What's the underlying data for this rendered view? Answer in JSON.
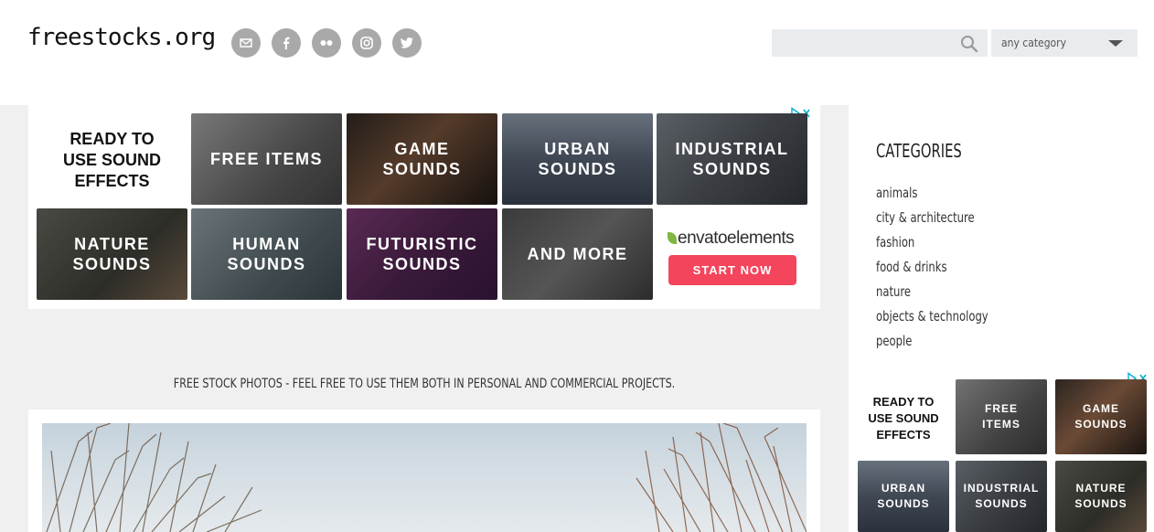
{
  "header": {
    "logo": "freestocks.org",
    "social": [
      "mail-icon",
      "facebook-icon",
      "flickr-icon",
      "instagram-icon",
      "twitter-icon"
    ],
    "search": {
      "placeholder": "",
      "value": ""
    },
    "category_select": "any category"
  },
  "ad_top": {
    "headline": [
      "READY TO",
      "USE SOUND",
      "EFFECTS"
    ],
    "tiles": [
      {
        "label": [
          "FREE ITEMS"
        ]
      },
      {
        "label": [
          "GAME",
          "SOUNDS"
        ]
      },
      {
        "label": [
          "URBAN",
          "SOUNDS"
        ]
      },
      {
        "label": [
          "INDUSTRIAL",
          "SOUNDS"
        ]
      },
      {
        "label": [
          "NATURE",
          "SOUNDS"
        ]
      },
      {
        "label": [
          "HUMAN",
          "SOUNDS"
        ]
      },
      {
        "label": [
          "FUTURISTIC",
          "SOUNDS"
        ]
      },
      {
        "label": [
          "AND MORE"
        ]
      }
    ],
    "brand": "envato",
    "brand_suffix": "elements",
    "cta": "START NOW"
  },
  "tagline": "FREE STOCK PHOTOS - FEEL FREE TO USE THEM BOTH IN PERSONAL AND COMMERCIAL PROJECTS.",
  "sidebar": {
    "title": "CATEGORIES",
    "items": [
      "animals",
      "city & architecture",
      "fashion",
      "food & drinks",
      "nature",
      "objects & technology",
      "people"
    ]
  },
  "ad_side": {
    "headline": [
      "READY TO",
      "USE SOUND",
      "EFFECTS"
    ],
    "tiles": [
      {
        "label": [
          "FREE",
          "ITEMS"
        ]
      },
      {
        "label": [
          "GAME",
          "SOUNDS"
        ]
      },
      {
        "label": [
          "URBAN",
          "SOUNDS"
        ]
      },
      {
        "label": [
          "INDUSTRIAL",
          "SOUNDS"
        ]
      },
      {
        "label": [
          "NATURE",
          "SOUNDS"
        ]
      }
    ]
  },
  "colors": {
    "social_bg": "#a9a9a9",
    "search_bg": "#e9ecef",
    "cta": "#f5455c",
    "envato_green": "#82b541",
    "adchoices": "#00aecd"
  }
}
